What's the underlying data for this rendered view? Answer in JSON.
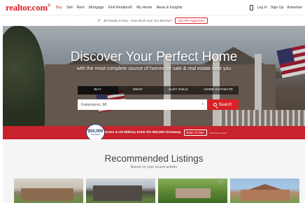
{
  "header": {
    "logo": "realtor.com",
    "logo_tm": "®",
    "nav": [
      "Buy",
      "Sell",
      "Rent",
      "Mortgage",
      "Find Realtors®",
      "My Home",
      "News & Insights"
    ],
    "login": "Log In",
    "signup": "Sign Up",
    "advertise": "Advertise",
    "accent_color": "#d92228"
  },
  "promo": {
    "text": "Be Ready to Buy - How Much Can You Borrow?",
    "button": "Get Pre-Approved"
  },
  "hero": {
    "title": "Discover Your Perfect Home",
    "subtitle": "with the most complete source of homes for sale & real estate near you",
    "tabs": [
      "BUY",
      "RENT",
      "JUST SOLD",
      "HOME ESTIMATE"
    ],
    "active_tab": "BUY",
    "search_value": "Kalamazoo, MI",
    "search_button": "Search"
  },
  "banner": {
    "badge_amount": "$50,000",
    "badge_label": "GIVEAWAY",
    "message": "Veterans & US Military Enter the $50,000 Giveaway",
    "enter_button": "Enter To Win",
    "restrictions": "Restrictions Apply*"
  },
  "recommended": {
    "title": "Recommended Listings",
    "subtitle": "Based on your recent activity",
    "cards": [
      {
        "favorite_icon": "heart-outline-icon"
      },
      {
        "favorite_icon": "heart-outline-icon"
      },
      {
        "favorite_icon": "heart-outline-icon"
      },
      {
        "favorite_icon": "heart-outline-icon"
      }
    ]
  }
}
